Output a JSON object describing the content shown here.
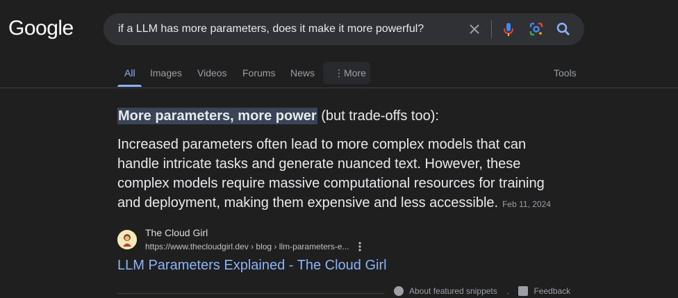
{
  "logo": "Google",
  "search": {
    "query": "if a LLM has more parameters, does it make it more powerful?"
  },
  "tabs": [
    {
      "label": "All"
    },
    {
      "label": "Images"
    },
    {
      "label": "Videos"
    },
    {
      "label": "Forums"
    },
    {
      "label": "News"
    },
    {
      "label": "More"
    }
  ],
  "tools_label": "Tools",
  "snippet": {
    "highlight": "More parameters, more power",
    "head_rest": " (but trade-offs too):",
    "body": "Increased parameters often lead to more complex models that can handle intricate tasks and generate nuanced text. However, these complex models require massive computational resources for training and deployment, making them expensive and less accessible.",
    "date": "Feb 11, 2024"
  },
  "source": {
    "name": "The Cloud Girl",
    "url": "https://www.thecloudgirl.dev › blog › llm-parameters-e...",
    "title": "LLM Parameters Explained - The Cloud Girl"
  },
  "footer": {
    "about": "About featured snippets",
    "separator": "·",
    "feedback": "Feedback"
  },
  "colors": {
    "background": "#1f1f1f",
    "link": "#8ab4f8",
    "highlight": "#394457"
  }
}
